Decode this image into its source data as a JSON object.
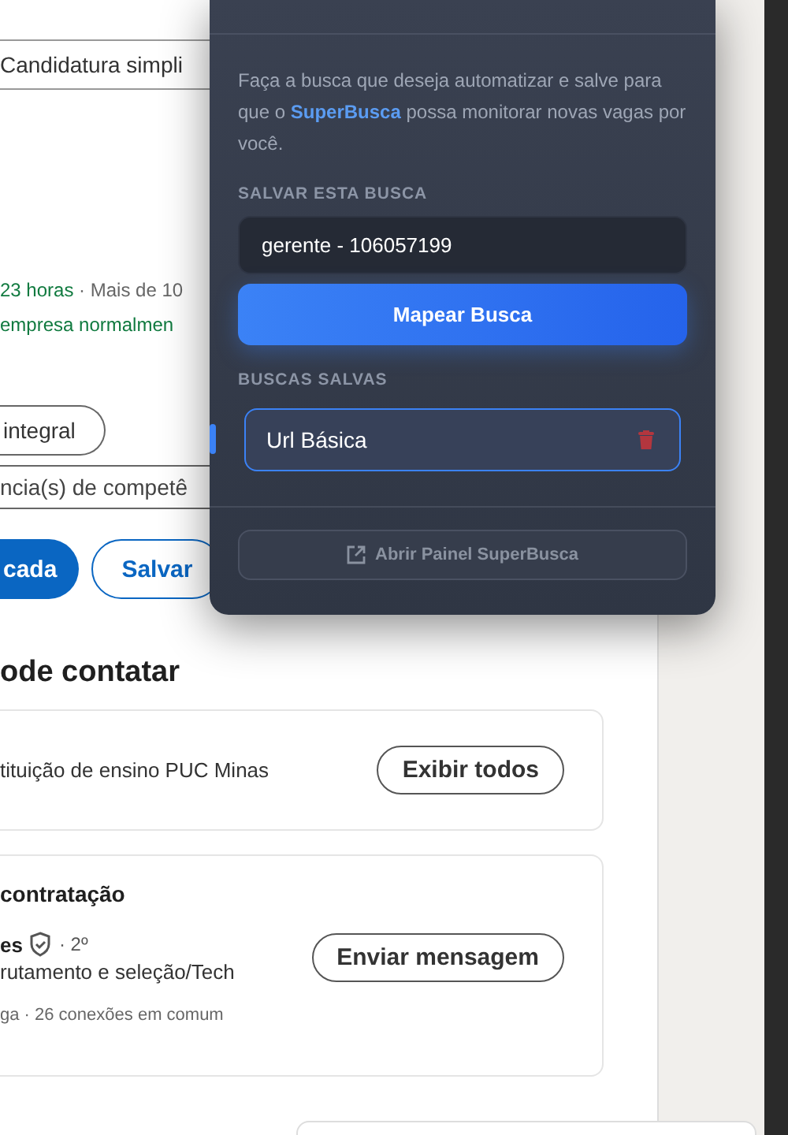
{
  "page": {
    "filter_field": "Candidatura simpli",
    "posted": {
      "age": "23 horas",
      "rest": " · Mais de 10"
    },
    "response_note": "empresa normalmen",
    "tags": [
      {
        "label": "integral",
        "kind": "pill"
      },
      {
        "label": "ncia(s) de competê",
        "kind": "field"
      }
    ],
    "actions": [
      {
        "label": "cada",
        "kind": "primary"
      },
      {
        "label": "Salvar",
        "kind": "outline"
      }
    ],
    "contacts_heading": "ode contatar",
    "school_card": {
      "text": "tituição de ensino PUC Minas",
      "button": "Exibir todos"
    },
    "hiring_card": {
      "title": "contratação",
      "name": "es",
      "degree": "· 2º",
      "role": "rutamento e seleção/Tech",
      "meta": "ga · 26 conexões em comum",
      "button": "Enviar mensagem"
    }
  },
  "popup": {
    "description": "Faça a busca que deseja automatizar e salve para que o **SuperBusca** possa monitorar novas vagas por você.",
    "save_label": "SALVAR ESTA BUSCA",
    "search_value": "gerente - 106057199",
    "map_button": "Mapear Busca",
    "saved_label": "BUSCAS SALVAS",
    "saved": [
      {
        "name": "Url Básica",
        "selected": true
      }
    ],
    "footer_button": "Abrir Painel SuperBusca"
  }
}
